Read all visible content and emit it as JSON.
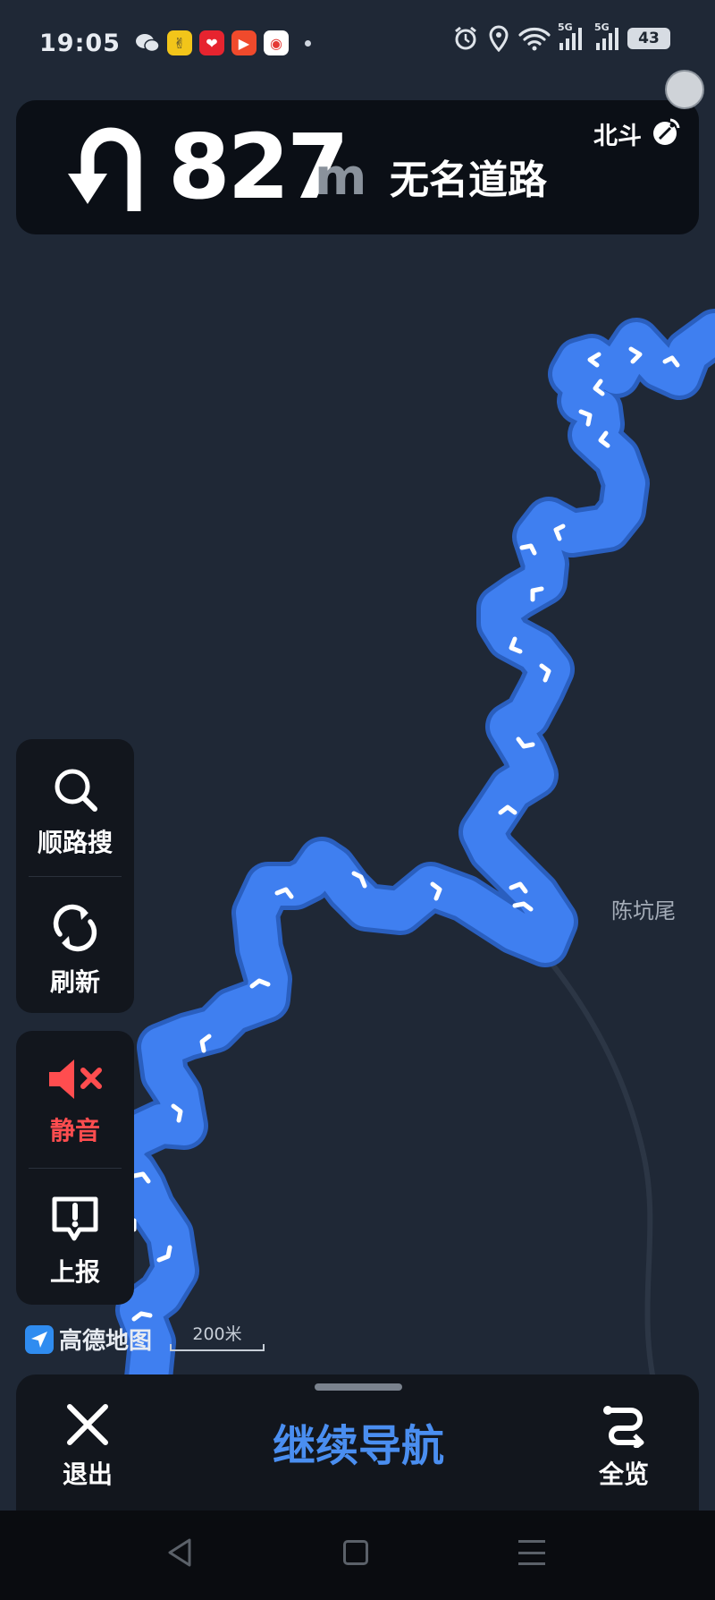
{
  "status_bar": {
    "time": "19:05",
    "network": "5G",
    "battery": "43",
    "app_icons": [
      "wechat-icon",
      "app-yellow-icon",
      "app-red-icon",
      "video-icon",
      "media-icon"
    ],
    "system_icons": [
      "alarm-icon",
      "location-icon",
      "wifi-icon",
      "signal-5g-icon",
      "signal-5g-icon",
      "battery-icon"
    ]
  },
  "guidance": {
    "turn_icon": "u-turn-icon",
    "distance": "827",
    "unit": "m",
    "road": "无名道路",
    "gps_label": "北斗",
    "gps_icon": "satellite-icon"
  },
  "map": {
    "place_label": "陈坑尾",
    "route_color": "#3f7ff0",
    "background_color": "#1f2836"
  },
  "side_controls": {
    "search_label": "顺路搜",
    "refresh_label": "刷新",
    "mute_label": "静音",
    "report_label": "上报",
    "mute_color": "#ff4d4f"
  },
  "brand": {
    "name": "高德地图",
    "scale": "200米"
  },
  "bottom_bar": {
    "exit_label": "退出",
    "continue_label": "继续导航",
    "overview_label": "全览",
    "continue_color": "#4a8ef0"
  }
}
